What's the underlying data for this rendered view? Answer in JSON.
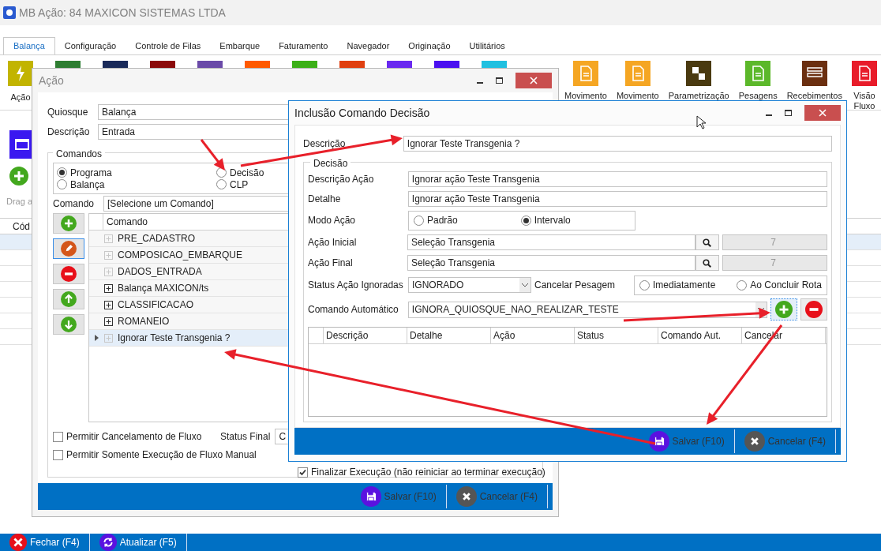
{
  "window": {
    "title": "MB Ação: 84 MAXICON SISTEMAS LTDA"
  },
  "menu_tabs": [
    {
      "label": "Balança",
      "selected": true
    },
    {
      "label": "Configuração",
      "selected": false
    },
    {
      "label": "Controle de Filas",
      "selected": false
    },
    {
      "label": "Embarque",
      "selected": false
    },
    {
      "label": "Faturamento",
      "selected": false
    },
    {
      "label": "Navegador",
      "selected": false
    },
    {
      "label": "Originação",
      "selected": false
    },
    {
      "label": "Utilitários",
      "selected": false
    }
  ],
  "ribbon_left": [
    {
      "label": "Ação",
      "color": "#c2b400"
    }
  ],
  "ribbon_hidden": [
    {
      "color": "#2e7d32"
    },
    {
      "color": "#1a2a5a"
    },
    {
      "color": "#8b0a0a"
    },
    {
      "color": "#6a4aa8"
    },
    {
      "color": "#ff5a00"
    },
    {
      "color": "#3cb018"
    },
    {
      "color": "#e04010"
    },
    {
      "color": "#6a2af0"
    },
    {
      "color": "#4a10f0"
    },
    {
      "color": "#20c0e0"
    }
  ],
  "ribbon_right": [
    {
      "label": "Movimento",
      "color": "#f5a623",
      "kind": "doc"
    },
    {
      "label": "Movimento",
      "color": "#f5a623",
      "kind": "doc"
    },
    {
      "label": "Parametrização",
      "color": "#4a3a10",
      "kind": "grid"
    },
    {
      "label": "Pesagens",
      "color": "#5cb82a",
      "kind": "doc"
    },
    {
      "label": "Recebimentos",
      "color": "#6b2f10",
      "kind": "list"
    },
    {
      "label": "Visão Fluxo",
      "color": "#e81c2a",
      "kind": "doc"
    }
  ],
  "main_panel": {
    "drag_hint": "Drag a",
    "grid_column": "Cód"
  },
  "footer_buttons": [
    {
      "label": "Fechar (F4)",
      "kind": "close"
    },
    {
      "label": "Atualizar (F5)",
      "kind": "refresh"
    }
  ],
  "acao_dialog": {
    "title": "Ação",
    "fields": [
      {
        "label": "Quiosque",
        "value": "Balança"
      },
      {
        "label": "Descrição",
        "value": "Entrada"
      }
    ],
    "comandos": {
      "title": "Comandos",
      "types": [
        {
          "label": "Programa",
          "selected": true
        },
        {
          "label": "Balança",
          "selected": false
        },
        {
          "label": "Decisão",
          "selected": false
        },
        {
          "label": "CLP",
          "selected": false
        }
      ],
      "comando_label": "Comando",
      "comando_value": "[Selecione um Comando]",
      "side_buttons": [
        {
          "kind": "add"
        },
        {
          "kind": "edit"
        },
        {
          "kind": "remove"
        },
        {
          "kind": "up"
        },
        {
          "kind": "down"
        }
      ],
      "tree_column": "Comando",
      "tree_rows": [
        {
          "label": "PRE_CADASTRO",
          "expandable": false,
          "selected": false
        },
        {
          "label": "COMPOSICAO_EMBARQUE",
          "expandable": false,
          "selected": false
        },
        {
          "label": "DADOS_ENTRADA",
          "expandable": false,
          "selected": false
        },
        {
          "label": "Balança MAXICON/ts",
          "expandable": true,
          "selected": false
        },
        {
          "label": "CLASSIFICACAO",
          "expandable": true,
          "selected": false
        },
        {
          "label": "ROMANEIO",
          "expandable": true,
          "selected": false
        },
        {
          "label": "Ignorar Teste Transgenia ?",
          "expandable": false,
          "selected": true
        }
      ]
    },
    "options": [
      {
        "label": "Permitir Cancelamento de Fluxo",
        "checked": false
      },
      {
        "label": "Permitir Somente Execução de Fluxo Manual",
        "checked": false
      }
    ],
    "status_final": {
      "label": "Status Final",
      "value": "C"
    },
    "finalizar": {
      "label": "Finalizar Execução (não reiniciar ao terminar execução)",
      "checked": true
    },
    "buttons": [
      {
        "label": "Salvar (F10)",
        "kind": "save"
      },
      {
        "label": "Cancelar (F4)",
        "kind": "cancel"
      }
    ]
  },
  "decisao_dialog": {
    "title": "Inclusão Comando Decisão",
    "descricao": {
      "label": "Descrição",
      "value": "Ignorar Teste Transgenia ?"
    },
    "group_title": "Decisão",
    "descricao_acao": {
      "label": "Descrição Ação",
      "value": "Ignorar ação Teste Transgenia"
    },
    "detalhe": {
      "label": "Detalhe",
      "value": "Ignorar ação Teste Transgenia"
    },
    "modo_acao": {
      "label": "Modo Ação",
      "options": [
        {
          "label": "Padrão",
          "selected": false
        },
        {
          "label": "Intervalo",
          "selected": true
        }
      ]
    },
    "acao_inicial": {
      "label": "Ação Inicial",
      "value": "Seleção Transgenia",
      "code": "7"
    },
    "acao_final": {
      "label": "Ação Final",
      "value": "Seleção Transgenia",
      "code": "7"
    },
    "status_ignoradas": {
      "label": "Status Ação Ignoradas",
      "value": "IGNORADO"
    },
    "cancelar_pesagem": {
      "label": "Cancelar Pesagem",
      "options": [
        {
          "label": "Imediatamente",
          "selected": false
        },
        {
          "label": "Ao Concluir Rota",
          "selected": false
        }
      ]
    },
    "comando_automatico": {
      "label": "Comando Automático",
      "value": "IGNORA_QUIOSQUE_NAO_REALIZAR_TESTE"
    },
    "grid_columns": [
      "Descrição",
      "Detalhe",
      "Ação",
      "Status",
      "Comando Aut.",
      "Cancelar"
    ],
    "buttons": [
      {
        "label": "Salvar (F10)",
        "kind": "save"
      },
      {
        "label": "Cancelar (F4)",
        "kind": "cancel"
      }
    ]
  }
}
